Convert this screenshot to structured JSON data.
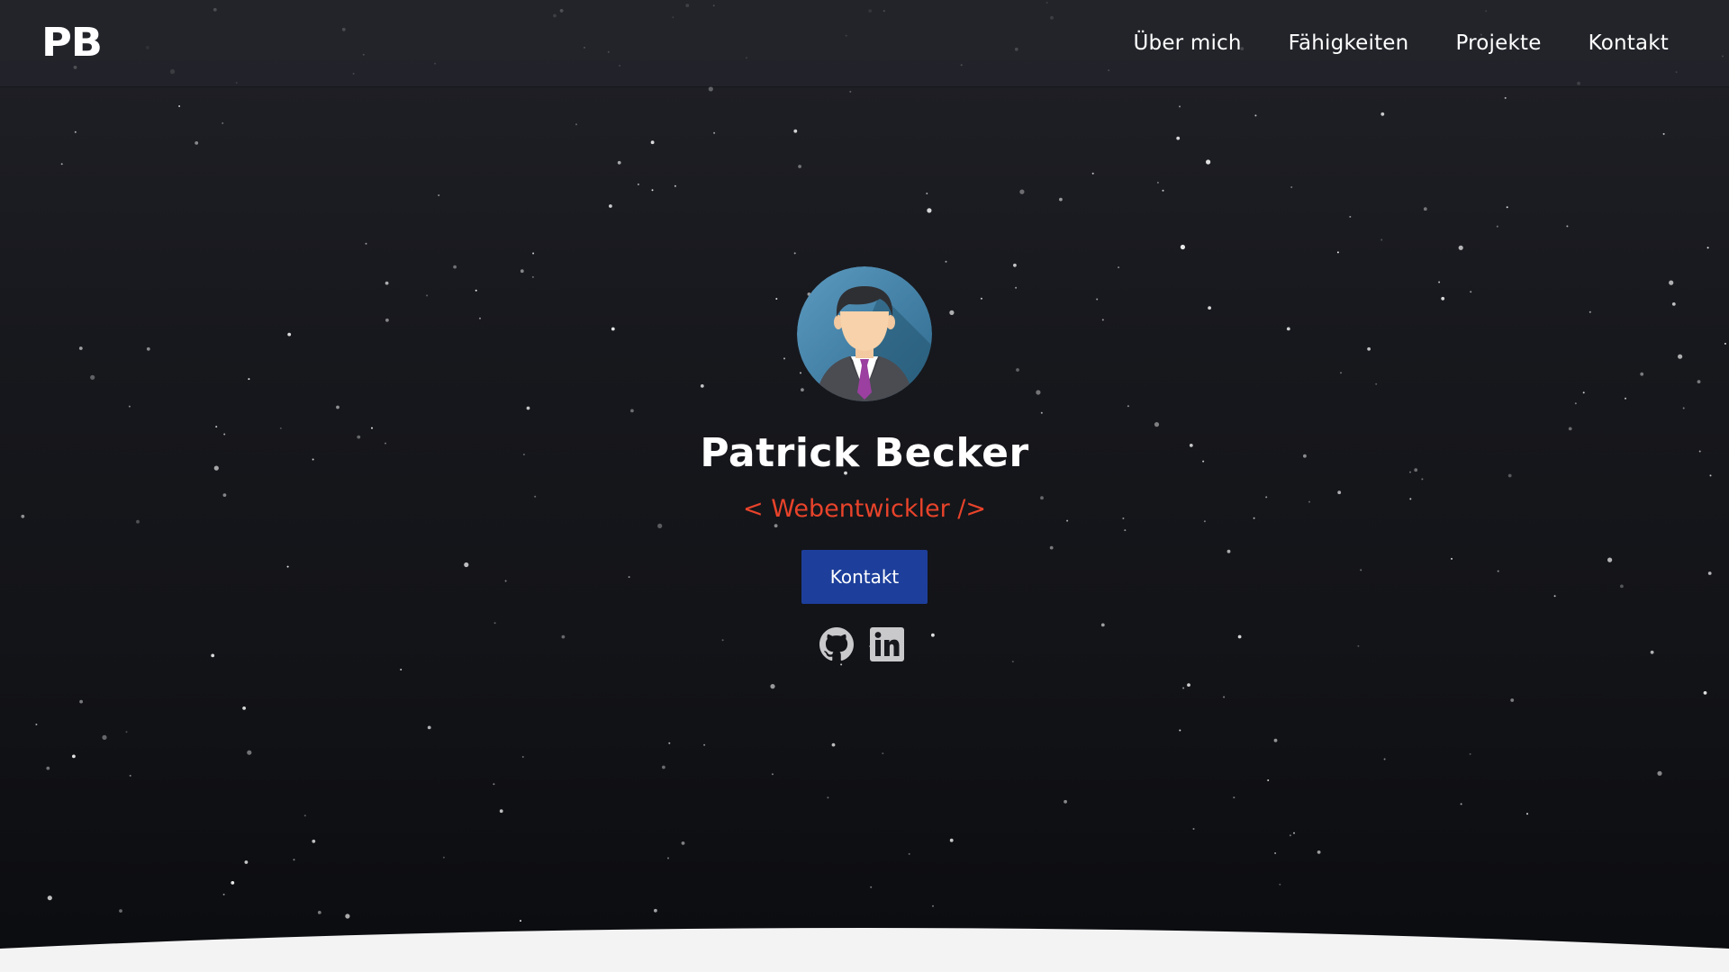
{
  "colors": {
    "background": "#17181d",
    "accent": "#e8432a",
    "button": "#1d3f9b",
    "icon": "#c9c9cc",
    "bottom_section": "#f3f3f4"
  },
  "navbar": {
    "logo": "PB",
    "links": [
      {
        "label": "Über mich"
      },
      {
        "label": "Fähigkeiten"
      },
      {
        "label": "Projekte"
      },
      {
        "label": "Kontakt"
      }
    ]
  },
  "hero": {
    "avatar_icon": "businessman-avatar",
    "name": "Patrick Becker",
    "role": "< Webentwickler />",
    "contact_button": "Kontakt",
    "social_icons": [
      "github-icon",
      "linkedin-icon"
    ]
  }
}
